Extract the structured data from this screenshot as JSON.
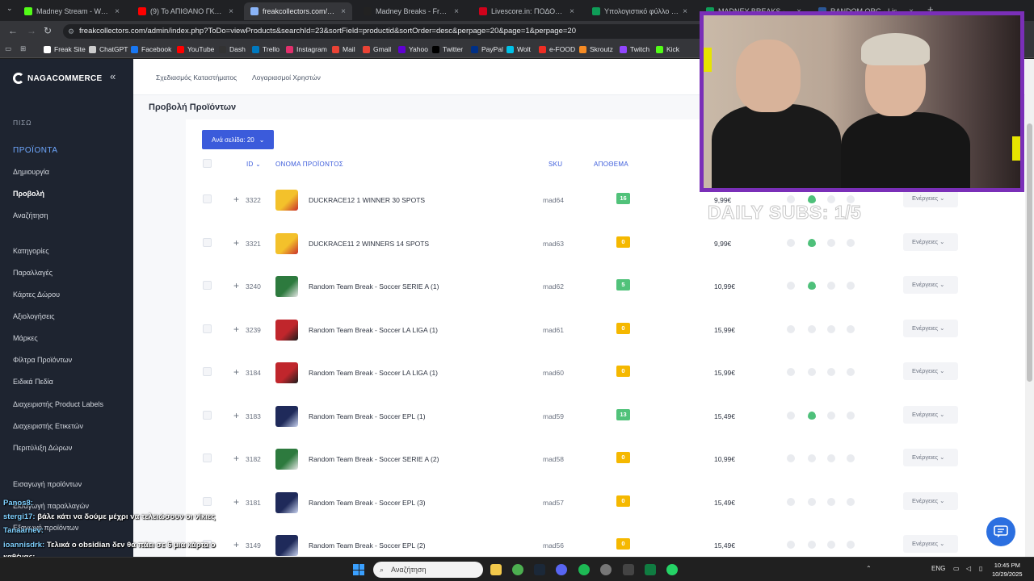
{
  "browser": {
    "tabs": [
      {
        "title": "Madney Stream - Watch Live",
        "color": "#53fc18"
      },
      {
        "title": "(9) Το ΑΠΙΘΑΝΟ ΓΚΟΛ του",
        "color": "#ff0000"
      },
      {
        "title": "freakcollectors.com/admin/i",
        "color": "#8ab4f8"
      },
      {
        "title": "Madney Breaks - Freak Colle",
        "color": "#222222"
      },
      {
        "title": "Livescore.in: ΠΟΔΟΣΦΑΙΡΟ",
        "color": "#d0021b"
      },
      {
        "title": "Υπολογιστικό φύλλο χωρίς",
        "color": "#0f9d58"
      },
      {
        "title": "MADNEY BREAKS - Υπολογ",
        "color": "#0f9d58"
      },
      {
        "title": "RANDOM.ORG - List Rando",
        "color": "#2b5797"
      }
    ],
    "new_tab": "+",
    "url": "freakcollectors.com/admin/index.php?ToDo=viewProducts&searchId=23&sortField=productid&sortOrder=desc&perpage=20&page=1&perpage=20",
    "bookmarks": [
      {
        "label": "Freak Site",
        "color": "#ffffff"
      },
      {
        "label": "ChatGPT",
        "color": "#cccccc"
      },
      {
        "label": "Facebook",
        "color": "#1877f2"
      },
      {
        "label": "YouTube",
        "color": "#ff0000"
      },
      {
        "label": "Dash",
        "color": "#333333"
      },
      {
        "label": "Trello",
        "color": "#0079bf"
      },
      {
        "label": "Instagram",
        "color": "#e1306c"
      },
      {
        "label": "Mail",
        "color": "#ea4335"
      },
      {
        "label": "Gmail",
        "color": "#ea4335"
      },
      {
        "label": "Yahoo",
        "color": "#6001d2"
      },
      {
        "label": "Twitter",
        "color": "#000000"
      },
      {
        "label": "PayPal",
        "color": "#003087"
      },
      {
        "label": "Wolt",
        "color": "#00c2e8"
      },
      {
        "label": "e-FOOD",
        "color": "#ee2e24"
      },
      {
        "label": "Skroutz",
        "color": "#f68b24"
      },
      {
        "label": "Twitch",
        "color": "#9146ff"
      },
      {
        "label": "Kick",
        "color": "#53fc18"
      }
    ]
  },
  "sidebar": {
    "logo": "NAGACOMMERCE",
    "back": "ΠΙΣΩ",
    "section": "ΠΡΟΪΟΝΤΑ",
    "items": [
      "Δημιουργία",
      "Προβολή",
      "Αναζήτηση",
      "Κατηγορίες",
      "Παραλλαγές",
      "Κάρτες Δώρου",
      "Αξιολογήσεις",
      "Μάρκες",
      "Φίλτρα Προϊόντων",
      "Ειδικά Πεδία",
      "Διαχειριστής Product Labels",
      "Διαχειριστής Ετικετών",
      "Περιτύλιξη Δώρων",
      "Εισαγωγή προϊόντων",
      "Εισαγωγή παραλλαγών",
      "Εξαγωγή προϊόντων"
    ],
    "active_index": 1
  },
  "topnav": [
    "Σχεδιασμός Καταστήματος",
    "Λογαριασμοί Χρηστών"
  ],
  "page_title": "Προβολή Προϊόντων",
  "perpage_label": "Ανά σελίδα: 20",
  "columns": {
    "id": "ID",
    "name": "ΟΝΟΜΑ ΠΡΟΪΟΝΤΟΣ",
    "sku": "SKU",
    "stock": "ΑΠΟΘΕΜΑ"
  },
  "products": [
    {
      "id": "3322",
      "name": "DUCKRACE12 1 WINNER 30 SPOTS",
      "sku": "mad64",
      "stock": "16",
      "stock_color": "#51c27a",
      "price": "9,99€",
      "thumb": "duck",
      "eye": true,
      "action": "Ενέργειες"
    },
    {
      "id": "3321",
      "name": "DUCKRACE11 2 WINNERS 14 SPOTS",
      "sku": "mad63",
      "stock": "0",
      "stock_color": "#f5b800",
      "price": "9,99€",
      "thumb": "duck",
      "eye": true,
      "action": "Ενέργειες"
    },
    {
      "id": "3240",
      "name": "Random Team Break - Soccer SERIE A (1)",
      "sku": "mad62",
      "stock": "5",
      "stock_color": "#51c27a",
      "price": "10,99€",
      "thumb": "green",
      "eye": true,
      "action": "Ενέργειες"
    },
    {
      "id": "3239",
      "name": "Random Team Break - Soccer LA LIGA (1)",
      "sku": "mad61",
      "stock": "0",
      "stock_color": "#f5b800",
      "price": "15,99€",
      "thumb": "red",
      "eye": false,
      "action": "Ενέργειες"
    },
    {
      "id": "3184",
      "name": "Random Team Break - Soccer LA LIGA (1)",
      "sku": "mad60",
      "stock": "0",
      "stock_color": "#f5b800",
      "price": "15,99€",
      "thumb": "red",
      "eye": false,
      "action": "Ενέργειες"
    },
    {
      "id": "3183",
      "name": "Random Team Break - Soccer EPL (1)",
      "sku": "mad59",
      "stock": "13",
      "stock_color": "#51c27a",
      "price": "15,49€",
      "thumb": "navy",
      "eye": true,
      "action": "Ενέργειες"
    },
    {
      "id": "3182",
      "name": "Random Team Break - Soccer SERIE A (2)",
      "sku": "mad58",
      "stock": "0",
      "stock_color": "#f5b800",
      "price": "10,99€",
      "thumb": "green",
      "eye": false,
      "action": "Ενέργειες"
    },
    {
      "id": "3181",
      "name": "Random Team Break - Soccer EPL (3)",
      "sku": "mad57",
      "stock": "0",
      "stock_color": "#f5b800",
      "price": "15,49€",
      "thumb": "navy",
      "eye": false,
      "action": "Ενέργειες"
    },
    {
      "id": "3149",
      "name": "Random Team Break - Soccer EPL (2)",
      "sku": "mad56",
      "stock": "0",
      "stock_color": "#f5b800",
      "price": "15,49€",
      "thumb": "navy",
      "eye": false,
      "action": "Ενέργειες"
    }
  ],
  "overlay": {
    "daily_subs": "DAILY SUBS: 1/5"
  },
  "chat": [
    {
      "user": "Panos8:",
      "msg": ""
    },
    {
      "user": "stergi17:",
      "msg": "βάλε κάτι να δούμε μέχρι να τελειώσουν οι νίκιες"
    },
    {
      "user": "Tanaarnev:",
      "msg": ""
    },
    {
      "user": "ioannisdrk:",
      "msg": "Τελικά ο obsidian δεν θα πάει σε 6 μια κάρτα ο"
    },
    {
      "user": "",
      "msg": "καθένας;"
    },
    {
      "user": "kourkoutas8:",
      "msg": "kipro poso kanoume na erthoun?"
    }
  ],
  "taskbar": {
    "search_placeholder": "Αναζήτηση",
    "lang": "ENG",
    "time": "10:45 PM",
    "date": "10/29/2025"
  }
}
